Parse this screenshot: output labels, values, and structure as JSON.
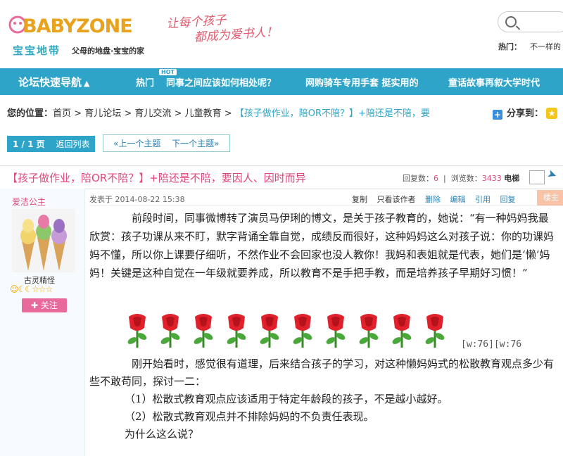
{
  "header": {
    "logo_word": "BABYZONE",
    "logo_cn": "宝宝地带",
    "logo_sub": "父母的地盘·宝宝的家",
    "slogan_line1": "让每个孩子",
    "slogan_line2": "都成为爱书人！",
    "hot_label": "热门：",
    "hot_text": "不一样的"
  },
  "nav": {
    "quick": "论坛快速导航",
    "hot_label": "热门",
    "hot_badge": "HOT",
    "links": [
      "同事之间应该如何相处呢？",
      "网购骑车专用手套 挺实用的",
      "童话故事再叙大学时代"
    ]
  },
  "crumb": {
    "label": "您的位置：",
    "items": [
      "首页",
      "育儿论坛",
      "育儿交流",
      "儿童教育"
    ],
    "current": "【孩子做作业，陪OR不陪？】+陪还是不陪，要",
    "share": "分享到："
  },
  "pager": {
    "page": "1 / 1 页",
    "back": "返回列表",
    "prev": "«上一个主题",
    "next": "下一个主题»"
  },
  "topic": {
    "title": "【孩子做作业，陪OR不陪？】+陪还是不陪，要因人、因时而异",
    "reply_label": "回复数：",
    "reply_count": "6",
    "view_label": "浏览数：",
    "view_count": "3433",
    "elevator": "电梯"
  },
  "author": {
    "name": "爱洁公主",
    "rank": "古灵精怪",
    "stars": "☺☾☾☆☆☆",
    "follow": "关注"
  },
  "post": {
    "meta": "发表于 2014-08-22 15:38",
    "actions": [
      "复制",
      "只看该作者",
      "删除",
      "编辑",
      "引用",
      "回复"
    ],
    "floor": "楼主",
    "p1": "前段时间，同事微博转了演员马伊琍的博文，是关于孩子教育的，她说：“有一种妈妈我最欣赏：孩子功课从来不盯，默字背诵全靠自觉，成绩反而很好，这种妈妈这么对孩子说：你的功课妈妈不懂，所以你上课要仔细听，不然作业不会回家也没人教你！我妈和表姐就是代表，她们是‘懒’妈妈！关键是这种自觉在一年级就要养成，所以教育不是手把手教，而是培养孩子早期好习惯！”",
    "wtag": "[w:76][w:76",
    "p2": "刚开始看时，感觉很有道理，后来结合孩子的学习，对这种懒妈妈式的松散教育观点多少有些不敢苟同，探讨一二：",
    "li1": "（1）松散式教育观点应该适用于特定年龄段的孩子，不是越小越好。",
    "li2": "（2）松散式教育观点并不排除妈妈的不负责任表现。",
    "q": "为什么这么说？"
  },
  "colors": {
    "accent": "#2ea5c8",
    "pink": "#e3457a",
    "rose": "#e0202a"
  }
}
